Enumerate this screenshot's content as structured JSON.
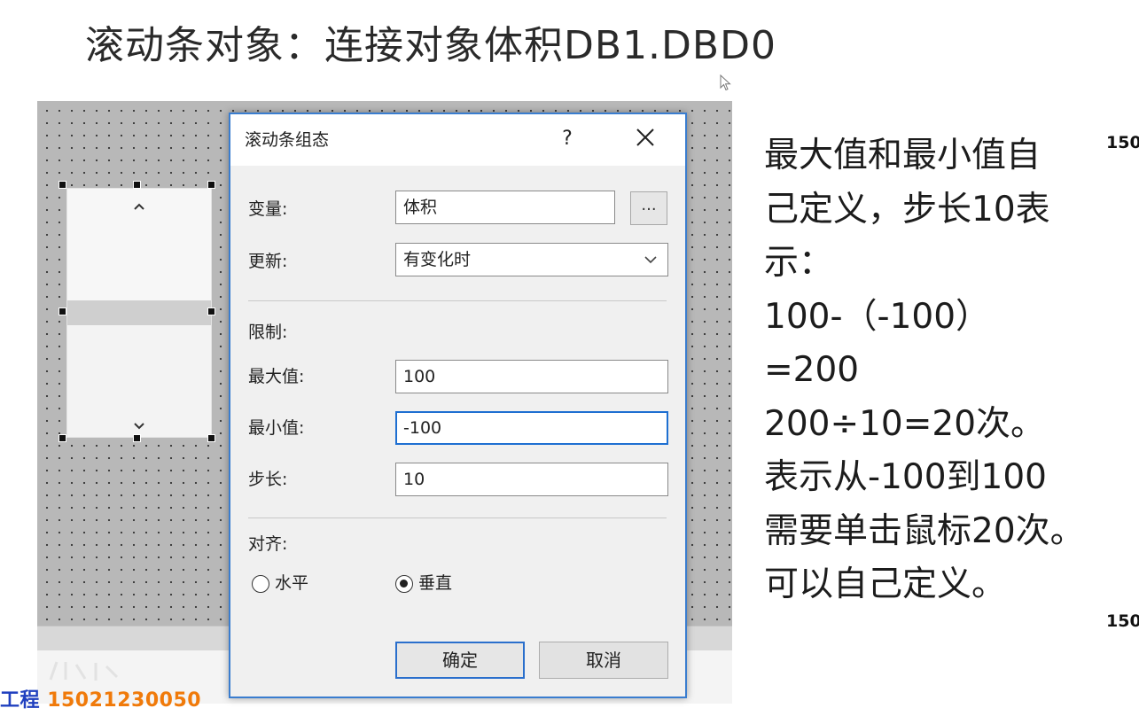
{
  "slide": {
    "title": "滚动条对象：连接对象体积DB1.DBD0"
  },
  "dialog": {
    "title": "滚动条组态",
    "help_label": "?",
    "variable_label": "变量:",
    "variable_value": "体积",
    "browse_label": "...",
    "update_label": "更新:",
    "update_value": "有变化时",
    "limits_label": "限制:",
    "max_label": "最大值:",
    "max_value": "100",
    "min_label": "最小值:",
    "min_value": "-100",
    "step_label": "步长:",
    "step_value": "10",
    "align_label": "对齐:",
    "horizontal_label": "水平",
    "vertical_label": "垂直",
    "horizontal_selected": false,
    "vertical_selected": true,
    "ok_label": "确定",
    "cancel_label": "取消"
  },
  "notes": {
    "lines": [
      "最大值和最小值自",
      "己定义，步长10表",
      "示：",
      "100-（-100）",
      "=200",
      "200÷10=20次。",
      "表示从-100到100",
      "需要单击鼠标20次。",
      "可以自己定义。"
    ],
    "edge_top": "150",
    "edge_bottom": "150"
  },
  "watermark": {
    "prefix": "工程",
    "number": "15021230050"
  },
  "icons": {
    "close": "close-icon",
    "dropdown": "chevron-down-icon",
    "scroll_up": "chevron-up-icon",
    "scroll_down": "chevron-down-icon",
    "cursor": "mouse-pointer-icon"
  },
  "colors": {
    "focus_border": "#1e6fd1",
    "dialog_border": "#3a7dcf",
    "watermark_number": "#f07a0a",
    "watermark_prefix": "#1f3fbf"
  }
}
